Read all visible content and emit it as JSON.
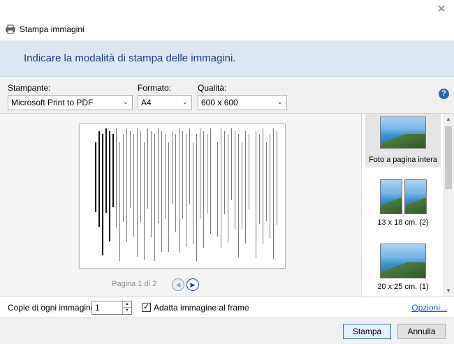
{
  "window": {
    "title": "Stampa immagini"
  },
  "banner": {
    "text": "Indicare la modalità di stampa delle immagini."
  },
  "printer": {
    "label": "Stampante:",
    "value": "Microsoft Print to PDF"
  },
  "format": {
    "label": "Formato:",
    "value": "A4"
  },
  "quality": {
    "label": "Qualità:",
    "value": "600 x 600"
  },
  "preview": {
    "page_label": "Pagina 1 di 2"
  },
  "layouts": [
    {
      "label": "Foto a pagina intera"
    },
    {
      "label": "13 x 18 cm. (2)"
    },
    {
      "label": "20 x 25 cm. (1)"
    }
  ],
  "copies": {
    "label": "Copie di ogni immagine:",
    "value": "1"
  },
  "fit": {
    "label": "Adatta immagine al frame",
    "checked": true
  },
  "options_link": "Opzioni...",
  "buttons": {
    "print": "Stampa",
    "cancel": "Annulla"
  },
  "colors": {
    "banner_bg": "#dbe8f4",
    "banner_text": "#1c3f76",
    "link": "#1a5bb8",
    "accent": "#2a6fd0"
  },
  "icons": {
    "close": "close-icon",
    "printer": "printer-icon",
    "help": "help-icon",
    "prev": "chevron-left-icon",
    "next": "chevron-right-icon"
  }
}
